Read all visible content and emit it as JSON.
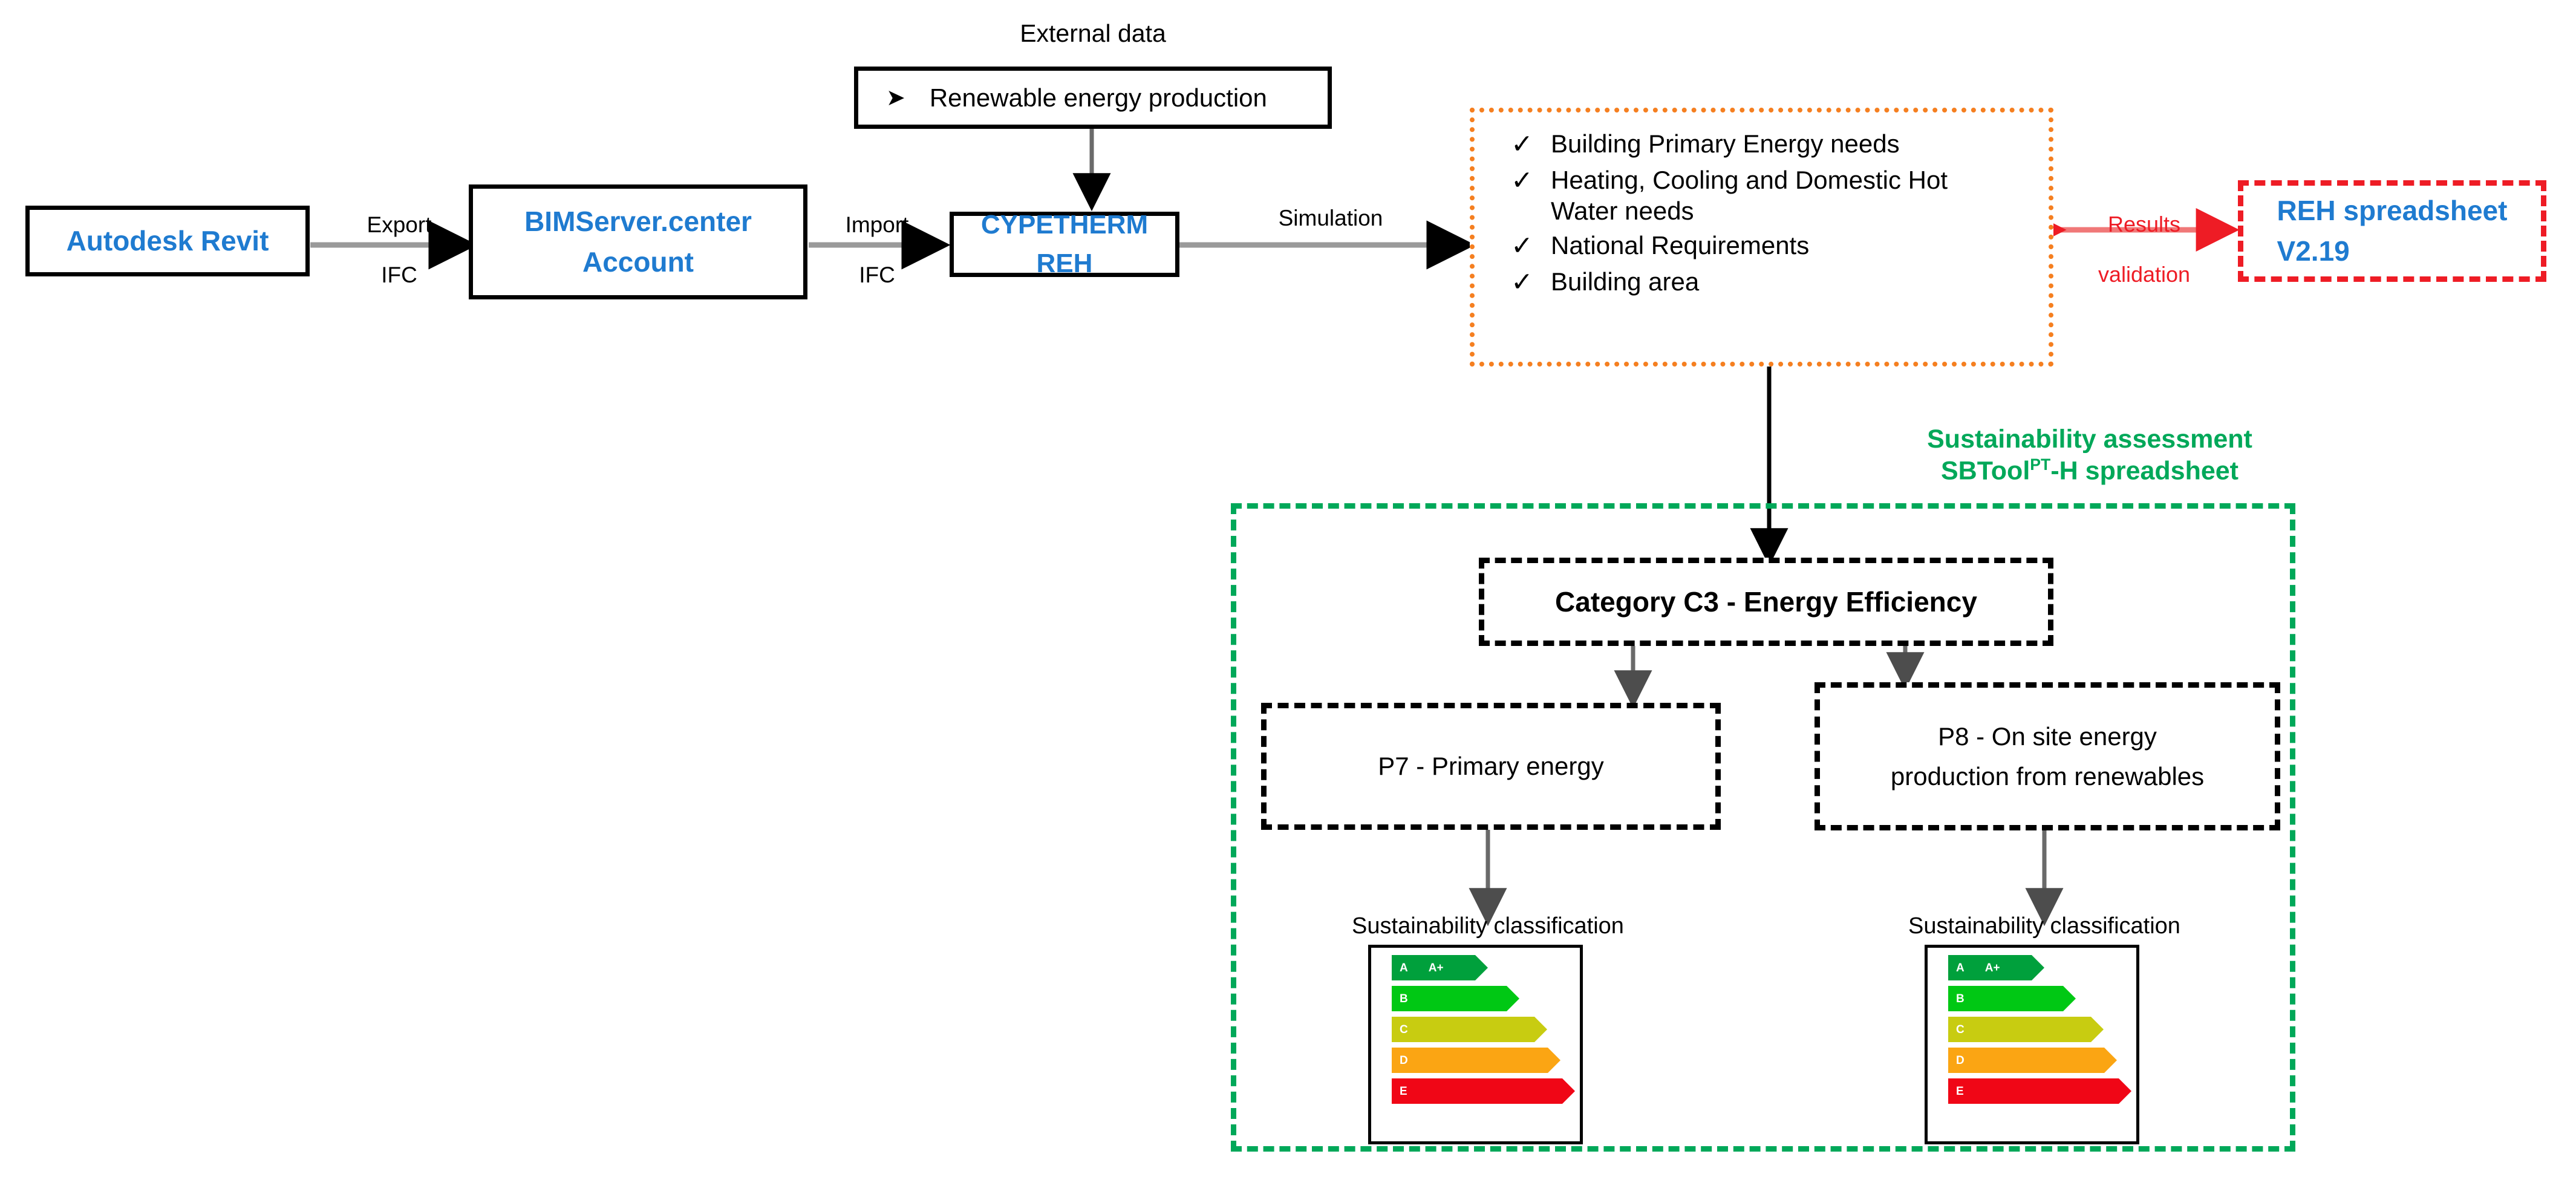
{
  "diagram": {
    "title": "BIM-based energy simulation and sustainability assessment workflow",
    "colors": {
      "blue_text": "#1F7BD0",
      "orange_border": "#F57F20",
      "red": "#EE1C25",
      "green": "#00A859",
      "black": "#000000"
    }
  },
  "nodes": {
    "autodesk_revit": {
      "label": "Autodesk Revit"
    },
    "bimserver": {
      "label": "BIMServer.center\nAccount"
    },
    "cypetherm": {
      "label": "CYPETHERM REH"
    },
    "external_data": {
      "caption": "External data",
      "bullet_icon": "arrow-bullet-icon",
      "bullet_text": "Renewable energy production"
    },
    "results_box": {
      "check_icon": "check-mark-icon",
      "items": [
        "Building Primary Energy needs",
        "Heating, Cooling and Domestic Hot Water needs",
        "National Requirements",
        "Building area"
      ]
    },
    "reh_spreadsheet": {
      "label": "REH spreadsheet\nV2.19"
    },
    "sbtool_container": {
      "title_line1": "Sustainability assessment",
      "title_line2_pre": "SBTool",
      "title_line2_sup": "PT",
      "title_line2_post": "-H spreadsheet"
    },
    "category_c3": {
      "label": "Category C3 - Energy Efficiency"
    },
    "p7": {
      "label": "P7 - Primary energy"
    },
    "p8": {
      "label": "P8 - On site energy\nproduction from renewables"
    },
    "classification_left": {
      "caption": "Sustainability classification"
    },
    "classification_right": {
      "caption": "Sustainability classification"
    }
  },
  "edges": {
    "revit_to_bimserver": {
      "label": "Export\nIFC"
    },
    "bimserver_to_cype": {
      "label": "Import\nIFC"
    },
    "cype_to_results": {
      "label": "Simulation"
    },
    "results_validation": {
      "label": "Results\nvalidation"
    }
  },
  "chart_data": {
    "type": "bar",
    "title": "Sustainability classification",
    "orientation": "horizontal",
    "categories": [
      "A",
      "B",
      "C",
      "D",
      "E"
    ],
    "values": [
      38,
      52,
      65,
      78,
      92
    ],
    "labels": [
      [
        "A",
        "A+"
      ],
      [
        "B"
      ],
      [
        "C"
      ],
      [
        "D"
      ],
      [
        "E"
      ]
    ],
    "colors": [
      "#00A03C",
      "#00C814",
      "#C8CC11",
      "#FBA513",
      "#F00616"
    ],
    "xlabel": "",
    "ylabel": "",
    "grid": false,
    "legend": "none",
    "note": "Energy-label style stepped bars; width increases from class A (best) to class E (worst)"
  }
}
